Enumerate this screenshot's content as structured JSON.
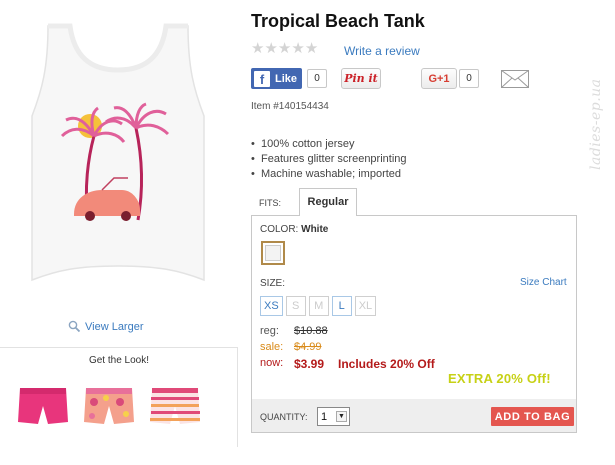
{
  "product": {
    "title": "Tropical Beach Tank",
    "write_review": "Write a review",
    "item_number": "Item #140154434",
    "view_larger": "View Larger",
    "features": [
      "100% cotton jersey",
      "Features glitter screenprinting",
      "Machine washable; imported"
    ],
    "rating_stars": 0
  },
  "social": {
    "fb_label": "Like",
    "fb_count": "0",
    "pin_label": "Pin it",
    "gplus_label": "G+1",
    "gplus_count": "0"
  },
  "fits": {
    "label": "FITS:",
    "tab": "Regular"
  },
  "color": {
    "label": "COLOR:",
    "value": "White",
    "swatch_color": "#f3f3f3"
  },
  "size": {
    "label": "SIZE:",
    "chart_link": "Size Chart",
    "options": [
      {
        "label": "XS",
        "available": true
      },
      {
        "label": "S",
        "available": false
      },
      {
        "label": "M",
        "available": false
      },
      {
        "label": "L",
        "available": true
      },
      {
        "label": "XL",
        "available": false
      }
    ]
  },
  "price": {
    "reg_label": "reg:",
    "reg_value": "$10.88",
    "sale_label": "sale:",
    "sale_value": "$4.99",
    "now_label": "now:",
    "now_value": "$3.99",
    "promo": "Includes 20% Off",
    "extra": "EXTRA 20% Off!"
  },
  "quantity": {
    "label": "QUANTITY:",
    "value": "1",
    "add_to_bag": "ADD TO BAG"
  },
  "get_the_look": {
    "title": "Get the Look!",
    "items": [
      "pink-shorts",
      "floral-shorts",
      "striped-shorts"
    ]
  },
  "watermark": "ladies-ep.ua",
  "colors": {
    "link": "#3b7bbf",
    "sale": "#d98b1a",
    "now": "#b41a1a",
    "extra": "#c7d116",
    "add_to_bag": "#e4564f",
    "facebook": "#4267b2",
    "pinterest": "#cb2027"
  }
}
